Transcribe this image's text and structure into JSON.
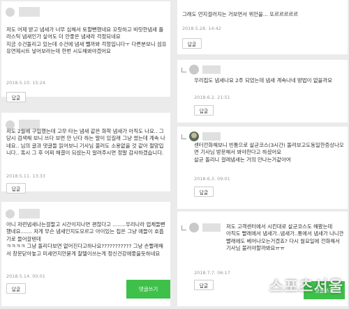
{
  "left": {
    "comments": [
      {
        "text": "저도 어제 받고 냄새가 너무 심해서 토할뻔했네요 꼬릿하고 비릿한냄새 플라스틱 냄새인가 싶어도 더 안좋은 냄새라 걱정되네요\n지금 수건돌리고 있는데 수건에 냄새 뺄까봐 걱정입니다ㅜ 다른분보니 섬유유연제시트 넣어보라는데 한번 시도해봐야겠어요",
        "date": "2018.5.10. 15:24",
        "reply_label": "답글"
      },
      {
        "text": "저도 2월에 구입했는데 고무 타는 냄새 같은 화학 냄새가 아직도 나요.. 그 당시 검색해 보니 쓰다 보면 안 난다 하는 말이 있길래 그냥 썼는데 계속 나네요.. 님의 글과 댓글들 읽어보니 기사님 불러도 소용없을 것 같아 절망입니다.. 혹시 그 후 어찌 해결이 되셨는지 알려주시면 정말 감사하겠습니다.",
        "date": "2018.5.11. 13:33",
        "reply_label": "답글"
      },
      {
        "text": "아니 저런냄새나는걸팔고 시간이지나면 괜찮다고 ........우리나라 업체들뻔했네요....... 저게 무슨 냄새인지도모르고 아이있는 집은 그냥 애들이 호흡기로 들어갈텐데\nㅋㅋㅋㅋ 그냥 돌리다보면 없어진다고하나요??????????? 그냥 손빨래해서 창문닫아놓고 미세먼지안묻게 찰텔이쓰는게 정신건강에좋을듯하네요",
        "date": "2018.5.14. 00:01",
        "reply_label": "답글"
      }
    ],
    "write_label": "댓글쓰기"
  },
  "right": {
    "top": {
      "text": "그래도 먼지걸러지는 거보면서 위안을... 또르르르르르",
      "date": "2018.5.28. 14:42",
      "reply_label": "답글"
    },
    "replies": [
      {
        "text": "우리집도 냄새나요 2주 되었는데 냄새 계속나네 방법이 없을까요",
        "date": "2018.6.2. 21:51",
        "reply_label": "답글"
      },
      {
        "text": "센터전화해보니 빈통으로 살균코스(3시간) 돌려보고도동일한증상나오면 기사님 방문해서 봐야한다고 하셨어요\n살균 돌리니 걸레냄새는 거의 안나는거같아여",
        "date": "2018.6.3. 09:01",
        "reply_label": "답글"
      },
      {
        "text": "저도 고객센터에서 시킨대로 살균코스도 해봤는데\n아직도 빨래에서 냄새가..냄새가..통에서 냄새가 나니깐 빨래에도 베어나오는거겠죠? 다시 월요일에 전화해서 기사님 불러야할까봐요ㅠㅠ",
        "date": "2018.7.7. 06:17",
        "reply_label": "답글"
      }
    ],
    "write_label": "댓글쓰기"
  },
  "watermark": "스포츠서울",
  "colors": {
    "write_button": "#3ec04a",
    "background": "#ebebeb"
  }
}
